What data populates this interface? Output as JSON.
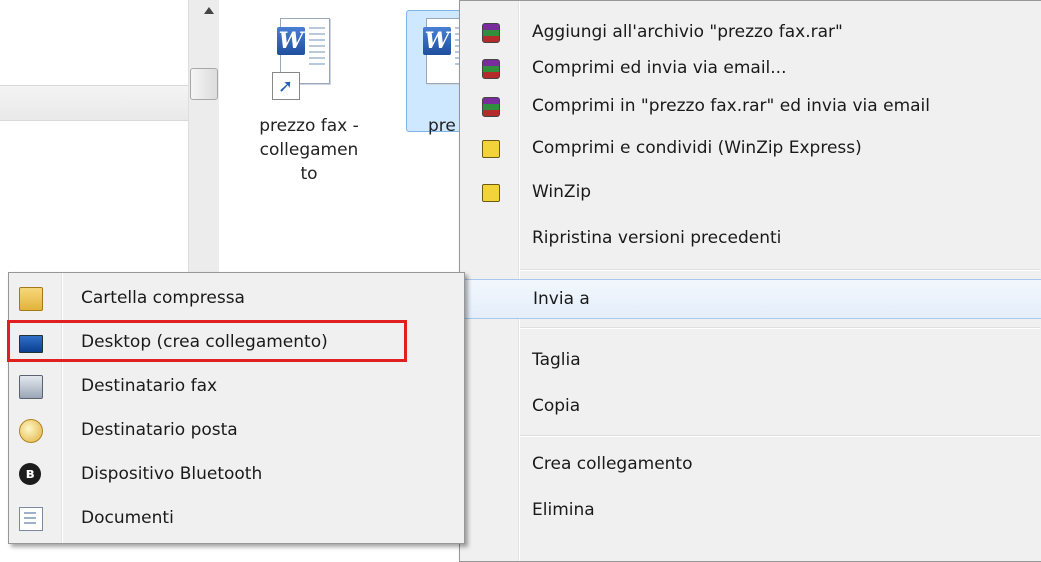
{
  "files": [
    {
      "label_lines": [
        "prezzo fax -",
        "collegamen",
        "to"
      ]
    },
    {
      "label_partial": "pre"
    }
  ],
  "context_menu": {
    "items": [
      {
        "label": "Aggiungi all'archivio \"prezzo fax.rar\"",
        "icon": "winrar-icon"
      },
      {
        "label": "Comprimi ed invia via email...",
        "icon": "winrar-icon"
      },
      {
        "label": "Comprimi in \"prezzo fax.rar\" ed invia via email",
        "icon": "winrar-icon"
      },
      {
        "label": "Comprimi e condividi (WinZip Express)",
        "icon": "winzip-icon"
      },
      {
        "label": "WinZip",
        "icon": "winzip-icon"
      },
      {
        "label": "Ripristina versioni precedenti",
        "icon": ""
      },
      {
        "label": "Invia a",
        "icon": "",
        "highlighted": true
      },
      {
        "label": "Taglia",
        "icon": ""
      },
      {
        "label": "Copia",
        "icon": ""
      },
      {
        "label": "Crea collegamento",
        "icon": ""
      },
      {
        "label": "Elimina",
        "icon": ""
      }
    ]
  },
  "send_to_submenu": {
    "items": [
      {
        "label": "Cartella compressa",
        "icon": "zip-folder-icon"
      },
      {
        "label": "Desktop (crea collegamento)",
        "icon": "desktop-icon",
        "outlined": true
      },
      {
        "label": "Destinatario fax",
        "icon": "fax-icon"
      },
      {
        "label": "Destinatario posta",
        "icon": "mail-icon"
      },
      {
        "label": "Dispositivo Bluetooth",
        "icon": "bluetooth-icon"
      },
      {
        "label": "Documenti",
        "icon": "documents-icon"
      }
    ],
    "highlight_color": "#e02020"
  }
}
